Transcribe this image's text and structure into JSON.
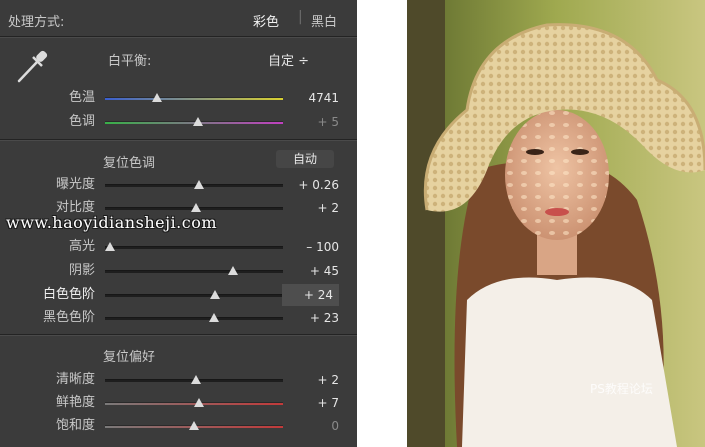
{
  "header": {
    "label": "处理方式:",
    "mode_color": "彩色",
    "mode_bw": "黑白"
  },
  "white_balance": {
    "label": "白平衡:",
    "value": "自定 ÷"
  },
  "temp": {
    "label": "色温",
    "value": "4741",
    "level": 0.29
  },
  "tint": {
    "label": "色调",
    "value": "+ 5",
    "level": 0.52
  },
  "tone_section": {
    "title": "复位色调",
    "auto": "自动"
  },
  "tone": [
    {
      "label": "曝光度",
      "value": "+ 0.26",
      "level": 0.53
    },
    {
      "label": "对比度",
      "value": "+ 2",
      "level": 0.51
    },
    {
      "label": "高光",
      "value": "– 100",
      "level": 0.03
    },
    {
      "label": "阴影",
      "value": "+ 45",
      "level": 0.72
    },
    {
      "label": "白色色阶",
      "value": "+ 24",
      "level": 0.62
    },
    {
      "label": "黑色色阶",
      "value": "+ 23",
      "level": 0.61
    }
  ],
  "presence_section": {
    "title": "复位偏好"
  },
  "presence": [
    {
      "label": "清晰度",
      "value": "+ 2",
      "level": 0.51
    },
    {
      "label": "鲜艳度",
      "value": "+ 7",
      "level": 0.53
    },
    {
      "label": "饱和度",
      "value": "0",
      "level": 0.5
    }
  ],
  "watermark": "www.haoyidiansheji.com",
  "photo_watermark": "PS教程论坛",
  "colors": {
    "panel": "#3b3b3b",
    "text": "#c8c8c8",
    "thumb": "#dcdcdc"
  },
  "icons": {
    "eyedropper": "eyedropper-icon"
  }
}
